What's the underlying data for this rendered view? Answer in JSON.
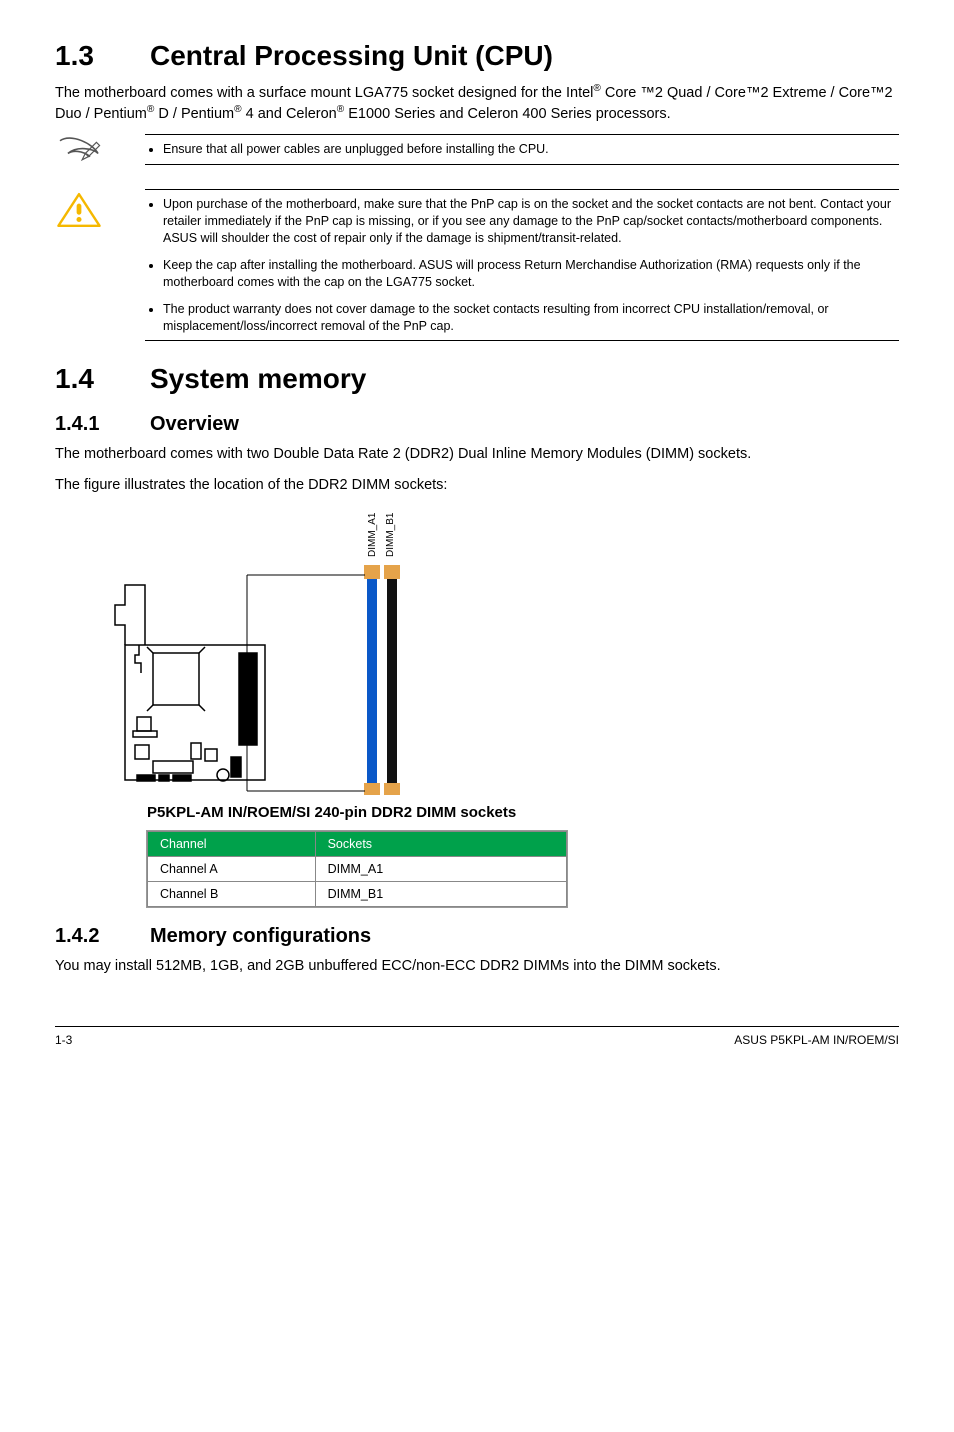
{
  "sec13": {
    "num": "1.3",
    "title": "Central Processing Unit (CPU)",
    "intro_parts": [
      "The motherboard comes with a surface mount LGA775 socket designed for the Intel",
      " Core ™2 Quad / Core™2 Extreme / Core™2 Duo / Pentium",
      " D / Pentium",
      " 4 and Celeron",
      " E1000 Series and Celeron 400 Series processors."
    ],
    "pencil_note": "Ensure that all power cables are unplugged before installing the CPU.",
    "warn_notes": [
      "Upon purchase of the motherboard, make sure that the PnP cap is on the socket and the socket contacts are not bent. Contact your retailer immediately if the PnP cap is missing, or if you see any damage to the PnP cap/socket contacts/motherboard components. ASUS will shoulder the cost of repair only if the damage is shipment/transit-related.",
      "Keep the cap after installing the motherboard. ASUS will process Return Merchandise Authorization (RMA) requests only if the motherboard comes with the cap on the LGA775 socket.",
      "The product warranty does not cover damage to the socket contacts resulting from incorrect CPU installation/removal, or misplacement/loss/incorrect removal of the PnP cap."
    ]
  },
  "sec14": {
    "num": "1.4",
    "title": "System memory"
  },
  "sec141": {
    "num": "1.4.1",
    "title": "Overview",
    "p1": "The motherboard comes with two Double Data Rate 2 (DDR2) Dual Inline Memory Modules (DIMM) sockets.",
    "p2": "The figure illustrates the location of the DDR2 DIMM sockets:",
    "dimm_labels": {
      "a": "DIMM_A1",
      "b": "DIMM_B1"
    },
    "caption": "P5KPL-AM IN/ROEM/SI 240-pin DDR2 DIMM sockets",
    "table": {
      "h1": "Channel",
      "h2": "Sockets",
      "rows": [
        {
          "c": "Channel A",
          "s": "DIMM_A1"
        },
        {
          "c": "Channel B",
          "s": "DIMM_B1"
        }
      ]
    }
  },
  "sec142": {
    "num": "1.4.2",
    "title": "Memory configurations",
    "p": "You may install 512MB, 1GB, and 2GB unbuffered ECC/non-ECC DDR2 DIMMs into the DIMM sockets."
  },
  "footer": {
    "left": "1-3",
    "right": "ASUS P5KPL-AM IN/ROEM/SI"
  }
}
